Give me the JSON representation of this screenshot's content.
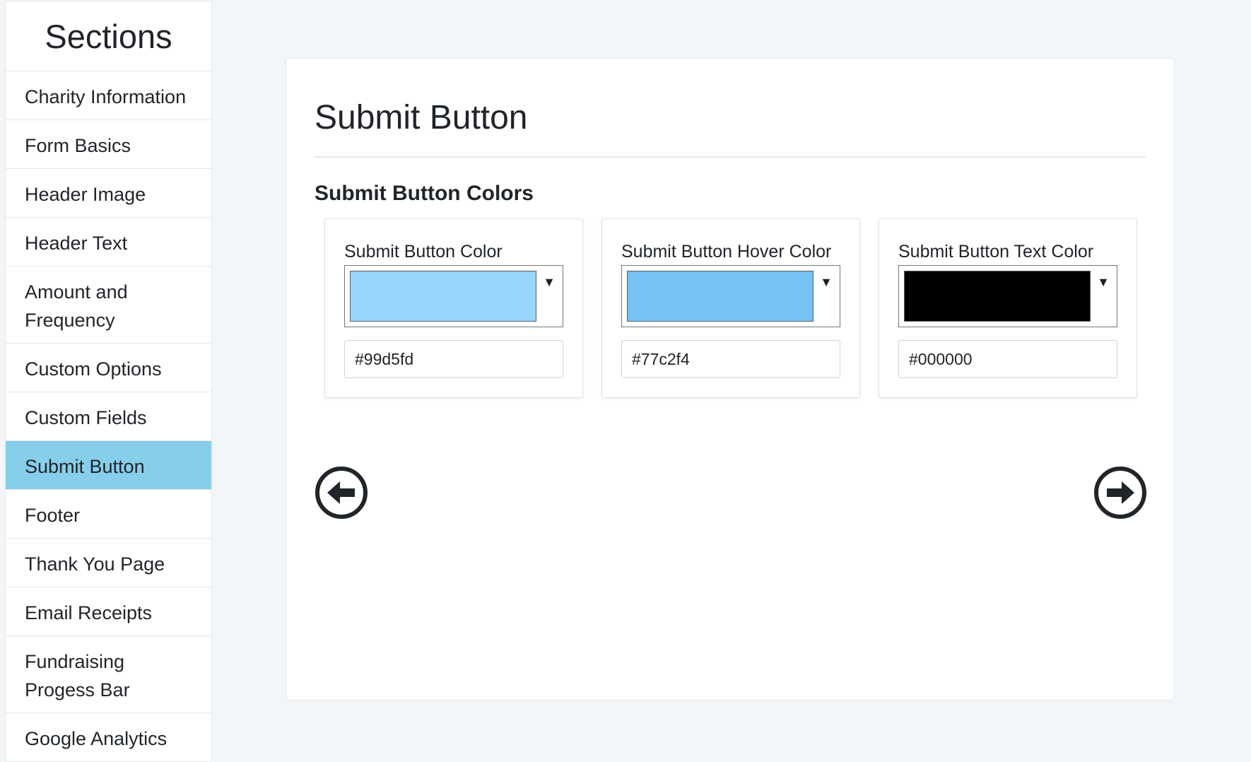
{
  "sidebar": {
    "title": "Sections",
    "items": [
      {
        "label": "Charity Information",
        "active": false
      },
      {
        "label": "Form Basics",
        "active": false
      },
      {
        "label": "Header Image",
        "active": false
      },
      {
        "label": "Header Text",
        "active": false
      },
      {
        "label": "Amount and Frequency",
        "active": false
      },
      {
        "label": "Custom Options",
        "active": false
      },
      {
        "label": "Custom Fields",
        "active": false
      },
      {
        "label": "Submit Button",
        "active": true
      },
      {
        "label": "Footer",
        "active": false
      },
      {
        "label": "Thank You Page",
        "active": false
      },
      {
        "label": "Email Receipts",
        "active": false
      },
      {
        "label": "Fundraising Progess Bar",
        "active": false
      },
      {
        "label": "Google Analytics",
        "active": false
      }
    ],
    "active_color": "#87ceeb"
  },
  "main": {
    "title": "Submit Button",
    "section_title": "Submit Button Colors",
    "colors": [
      {
        "label": "Submit Button Color",
        "value": "#99d5fd"
      },
      {
        "label": "Submit Button Hover Color",
        "value": "#77c2f4"
      },
      {
        "label": "Submit Button Text Color",
        "value": "#000000"
      }
    ],
    "prev_icon": "arrow-left-circle-icon",
    "next_icon": "arrow-right-circle-icon"
  }
}
